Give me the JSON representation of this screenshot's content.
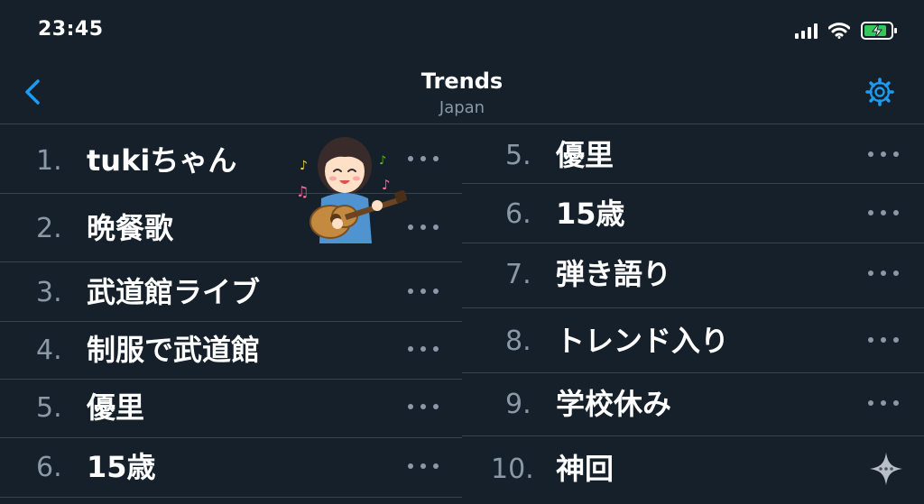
{
  "status_bar": {
    "time": "23:45",
    "icons": [
      "signal-icon",
      "wifi-icon",
      "battery-charging-icon"
    ]
  },
  "header": {
    "title": "Trends",
    "subtitle": "Japan",
    "back_icon": "chevron-left-icon",
    "settings_icon": "gear-icon"
  },
  "colors": {
    "background": "#15202b",
    "accent": "#1d9bf0",
    "muted": "#8b98a5",
    "divider": "#38444d"
  },
  "left_trends": [
    {
      "rank": "1.",
      "term": "tukiちゃん"
    },
    {
      "rank": "2.",
      "term": "晩餐歌"
    },
    {
      "rank": "3.",
      "term": "武道館ライブ"
    },
    {
      "rank": "4.",
      "term": "制服で武道館"
    },
    {
      "rank": "5.",
      "term": "優里"
    },
    {
      "rank": "6.",
      "term": "15歳"
    }
  ],
  "right_trends": [
    {
      "rank": "5.",
      "term": "優里"
    },
    {
      "rank": "6.",
      "term": "15歳"
    },
    {
      "rank": "7.",
      "term": "弾き語り"
    },
    {
      "rank": "8.",
      "term": "トレンド入り"
    },
    {
      "rank": "9.",
      "term": "学校休み"
    },
    {
      "rank": "10.",
      "term": "神回"
    }
  ],
  "sticker": "girl-playing-guitar-illustration",
  "sparkle_icon": "sparkle-icon"
}
